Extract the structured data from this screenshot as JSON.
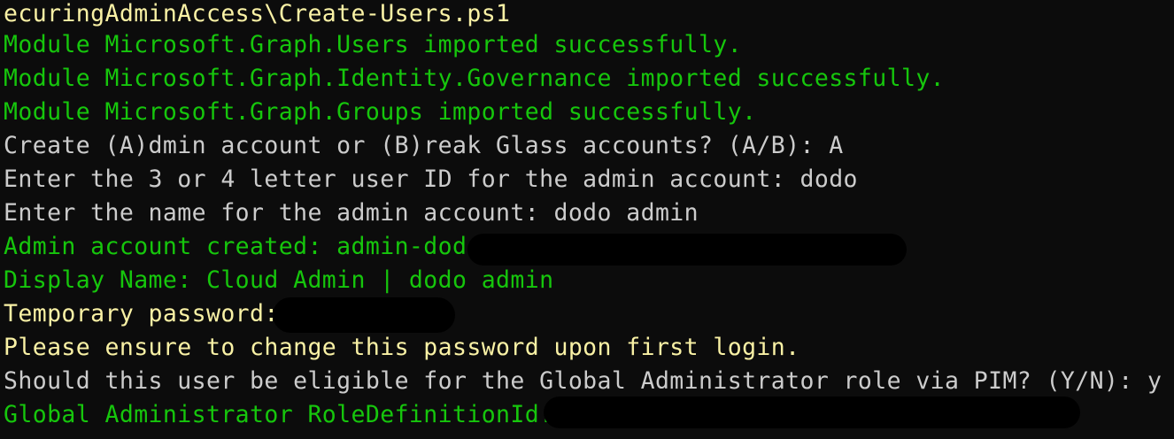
{
  "colors": {
    "background": "#0c0c0c",
    "yellow": "#f9f1a5",
    "green": "#16c60c",
    "white": "#cccccc",
    "redaction": "#000000"
  },
  "lines": [
    {
      "text": "ecuringAdminAccess\\Create-Users.ps1",
      "color": "yellow"
    },
    {
      "text": "Module Microsoft.Graph.Users imported successfully.",
      "color": "green"
    },
    {
      "text": "Module Microsoft.Graph.Identity.Governance imported successfully.",
      "color": "green"
    },
    {
      "text": "Module Microsoft.Graph.Groups imported successfully.",
      "color": "green"
    },
    {
      "text": "Create (A)dmin account or (B)reak Glass accounts? (A/B): A",
      "color": "white"
    },
    {
      "text": "Enter the 3 or 4 letter user ID for the admin account: dodo",
      "color": "white"
    },
    {
      "text": "Enter the name for the admin account: dodo admin",
      "color": "white"
    },
    {
      "text": "Admin account created: admin-dodo@",
      "color": "green"
    },
    {
      "text": "Display Name: Cloud Admin | dodo admin",
      "color": "green"
    },
    {
      "text": "Temporary password:",
      "color": "yellow"
    },
    {
      "text": "Please ensure to change this password upon first login.",
      "color": "yellow"
    },
    {
      "text": "Should this user be eligible for the Global Administrator role via PIM? (Y/N): y",
      "color": "white"
    },
    {
      "text": "Global Administrator RoleDefinitionId:",
      "color": "green"
    }
  ]
}
